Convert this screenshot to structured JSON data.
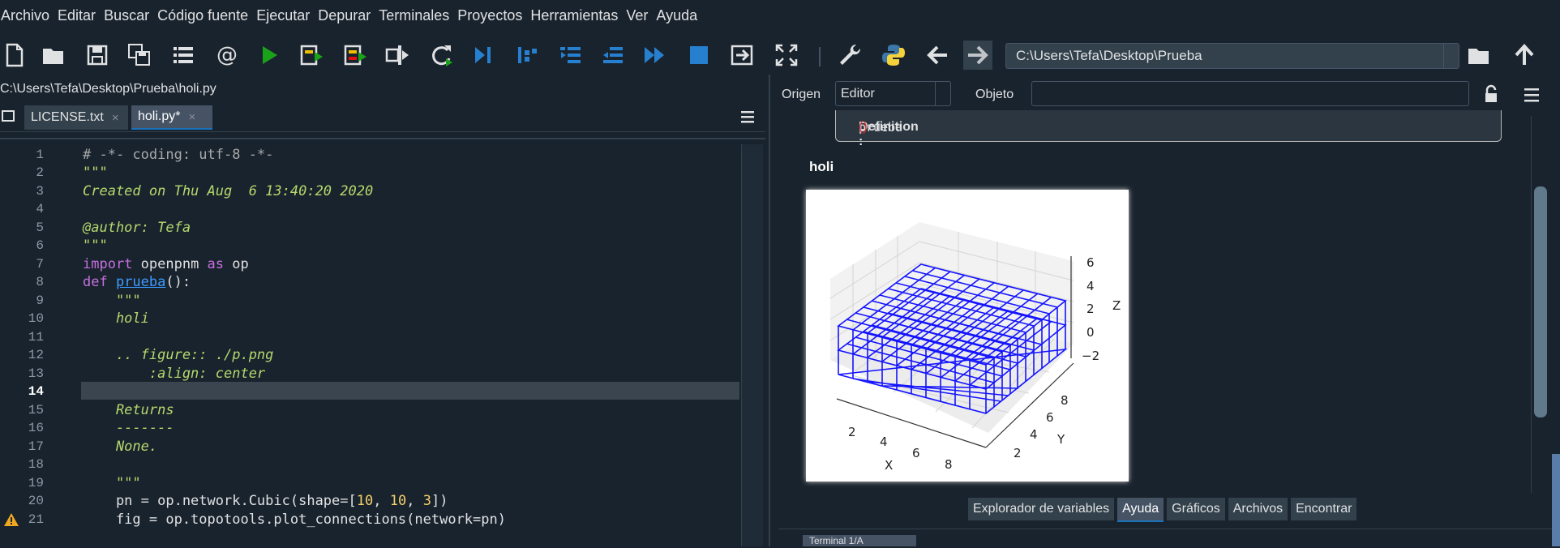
{
  "menu": [
    "Archivo",
    "Editar",
    "Buscar",
    "Código fuente",
    "Ejecutar",
    "Depurar",
    "Terminales",
    "Proyectos",
    "Herramientas",
    "Ver",
    "Ayuda"
  ],
  "toolbar": {
    "path_value": "C:\\Users\\Tefa\\Desktop\\Prueba",
    "icons": [
      "new-file-icon",
      "open-folder-icon",
      "save-icon",
      "save-all-icon",
      "outline-icon",
      "at-icon",
      "run-icon",
      "run-cell-icon",
      "run-cell-advance-icon",
      "run-selection-icon",
      "rerun-icon",
      "debug-icon",
      "step-icon",
      "step-into-icon",
      "step-return-icon",
      "continue-icon",
      "stop-icon",
      "exit-icon",
      "fullscreen-icon",
      "wrench-icon",
      "python-icon",
      "back-arrow-icon",
      "forward-arrow-icon",
      "browse-folder-icon",
      "parent-dir-icon"
    ]
  },
  "editor": {
    "path": "C:\\Users\\Tefa\\Desktop\\Prueba\\holi.py",
    "tabs": [
      {
        "label": "LICENSE.txt"
      },
      {
        "label": "holi.py*"
      }
    ],
    "line_numbers": [
      "1",
      "2",
      "3",
      "4",
      "5",
      "6",
      "7",
      "8",
      "9",
      "10",
      "11",
      "12",
      "13",
      "14",
      "15",
      "16",
      "17",
      "18",
      "19",
      "20",
      "21"
    ],
    "current_line": "14",
    "lines": {
      "l1": "# -*- coding: utf-8 -*-",
      "l2": "\"\"\"",
      "l3": "Created on Thu Aug  6 13:40:20 2020",
      "l5": "@author: Tefa",
      "l6": "\"\"\"",
      "l7_kw1": "import",
      "l7_mod": " openpnm ",
      "l7_kw2": "as",
      "l7_alias": " op",
      "l8_kw": "def ",
      "l8_fn": "prueba",
      "l8_rest": "():",
      "l9": "    \"\"\"",
      "l10": "    holi",
      "l12": "    .. figure:: ./p.png",
      "l13": "        :align: center",
      "l15": "    Returns",
      "l16": "    -------",
      "l17": "    None.",
      "l19": "    \"\"\"",
      "l20_a": "    pn = op.network.Cubic(shape=[",
      "l20_n1": "10",
      "l20_c1": ", ",
      "l20_n2": "10",
      "l20_c2": ", ",
      "l20_n3": "3",
      "l20_b": "])",
      "l21": "    fig = op.topotools.plot_connections(network=pn)"
    }
  },
  "help": {
    "origin_label": "Origen",
    "origin_value": "Editor",
    "object_label": "Objeto",
    "definition_label": "Definition : ",
    "definition_fn": "prueba",
    "definition_parens": "()",
    "title": "holi",
    "figure": {
      "x_ticks": [
        "2",
        "4",
        "6",
        "8"
      ],
      "y_ticks": [
        "2",
        "4",
        "6",
        "8"
      ],
      "z_ticks": [
        "6",
        "4",
        "2",
        "0",
        "−2"
      ],
      "x_label": "X",
      "y_label": "Y",
      "z_label": "Z"
    }
  },
  "pane_tabs": [
    {
      "label": "Explorador de variables",
      "active": false
    },
    {
      "label": "Ayuda",
      "active": true
    },
    {
      "label": "Gráficos",
      "active": false
    },
    {
      "label": "Archivos",
      "active": false
    },
    {
      "label": "Encontrar",
      "active": false
    }
  ],
  "terminal_tab": "Terminal 1/A"
}
